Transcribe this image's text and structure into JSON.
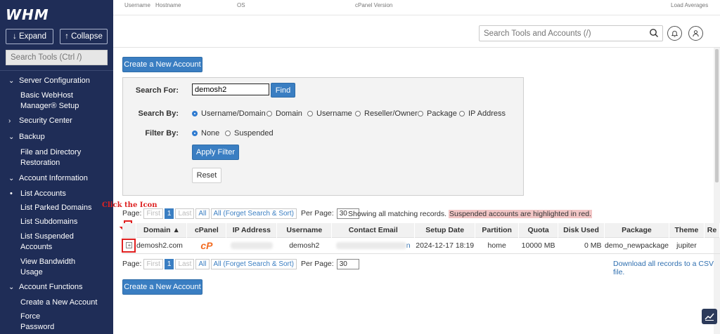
{
  "sidebar": {
    "logo": "WHM",
    "expand_label": "↓ Expand",
    "collapse_label": "↑ Collapse",
    "search_placeholder": "Search Tools (Ctrl /)",
    "items": [
      {
        "type": "section",
        "label": "Server Configuration"
      },
      {
        "type": "sub",
        "label": "Basic WebHost Manager® Setup"
      },
      {
        "type": "section",
        "label": "Security Center"
      },
      {
        "type": "section",
        "label": "Backup"
      },
      {
        "type": "sub",
        "label": "File and Directory Restoration"
      },
      {
        "type": "section",
        "label": "Account Information"
      },
      {
        "type": "sub",
        "label": "List Accounts"
      },
      {
        "type": "sub",
        "label": "List Parked Domains"
      },
      {
        "type": "sub",
        "label": "List Subdomains"
      },
      {
        "type": "sub",
        "label": "List Suspended Accounts"
      },
      {
        "type": "sub",
        "label": "View Bandwidth Usage"
      },
      {
        "type": "section",
        "label": "Account Functions"
      },
      {
        "type": "sub",
        "label": "Create a New Account"
      },
      {
        "type": "sub",
        "label": "Force Password Change"
      }
    ]
  },
  "topbar": {
    "username": "Username",
    "hostname": "Hostname",
    "os": "OS",
    "cpanel_version": "cPanel Version",
    "load_averages": "Load Averages"
  },
  "header": {
    "search_placeholder": "Search Tools and Accounts (/)"
  },
  "main": {
    "create_account_label": "Create a New Account",
    "search_for_label": "Search For:",
    "search_value": "demosh2",
    "find_label": "Find",
    "search_by_label": "Search By:",
    "search_by_options": [
      "Username/Domain",
      "Domain",
      "Username",
      "Reseller/Owner",
      "Package",
      "IP Address"
    ],
    "filter_by_label": "Filter By:",
    "filter_by_options": [
      "None",
      "Suspended"
    ],
    "apply_filter_label": "Apply Filter",
    "reset_label": "Reset",
    "pager": {
      "page_label": "Page:",
      "first": "First",
      "current": "1",
      "last": "Last",
      "all": "All",
      "all_forget": "All (Forget Search & Sort)",
      "per_page_label": "Per Page:",
      "per_page_value": "30"
    },
    "notice_text": "Showing all matching records.",
    "notice_red": "Suspended accounts are highlighted in red.",
    "table": {
      "headers": [
        "Domain ▲",
        "cPanel",
        "IP Address",
        "Username",
        "Contact Email",
        "Setup Date",
        "Partition",
        "Quota",
        "Disk Used",
        "Package",
        "Theme",
        "Re"
      ],
      "row": {
        "domain": "demosh2.com",
        "cpanel": "cP",
        "username": "demosh2",
        "email_suffix": "n",
        "setup_date": "2024-12-17 18:19",
        "partition": "home",
        "quota": "10000 MB",
        "disk_used": "0 MB",
        "package": "demo_newpackage",
        "theme": "jupiter"
      }
    },
    "csv_link": "Download all records to a CSV file."
  },
  "annotation": {
    "text": "Click the Icon"
  },
  "colors": {
    "sidebar_bg": "#1f2d57",
    "primary": "#3a7ec2",
    "annotation": "#e02020"
  }
}
